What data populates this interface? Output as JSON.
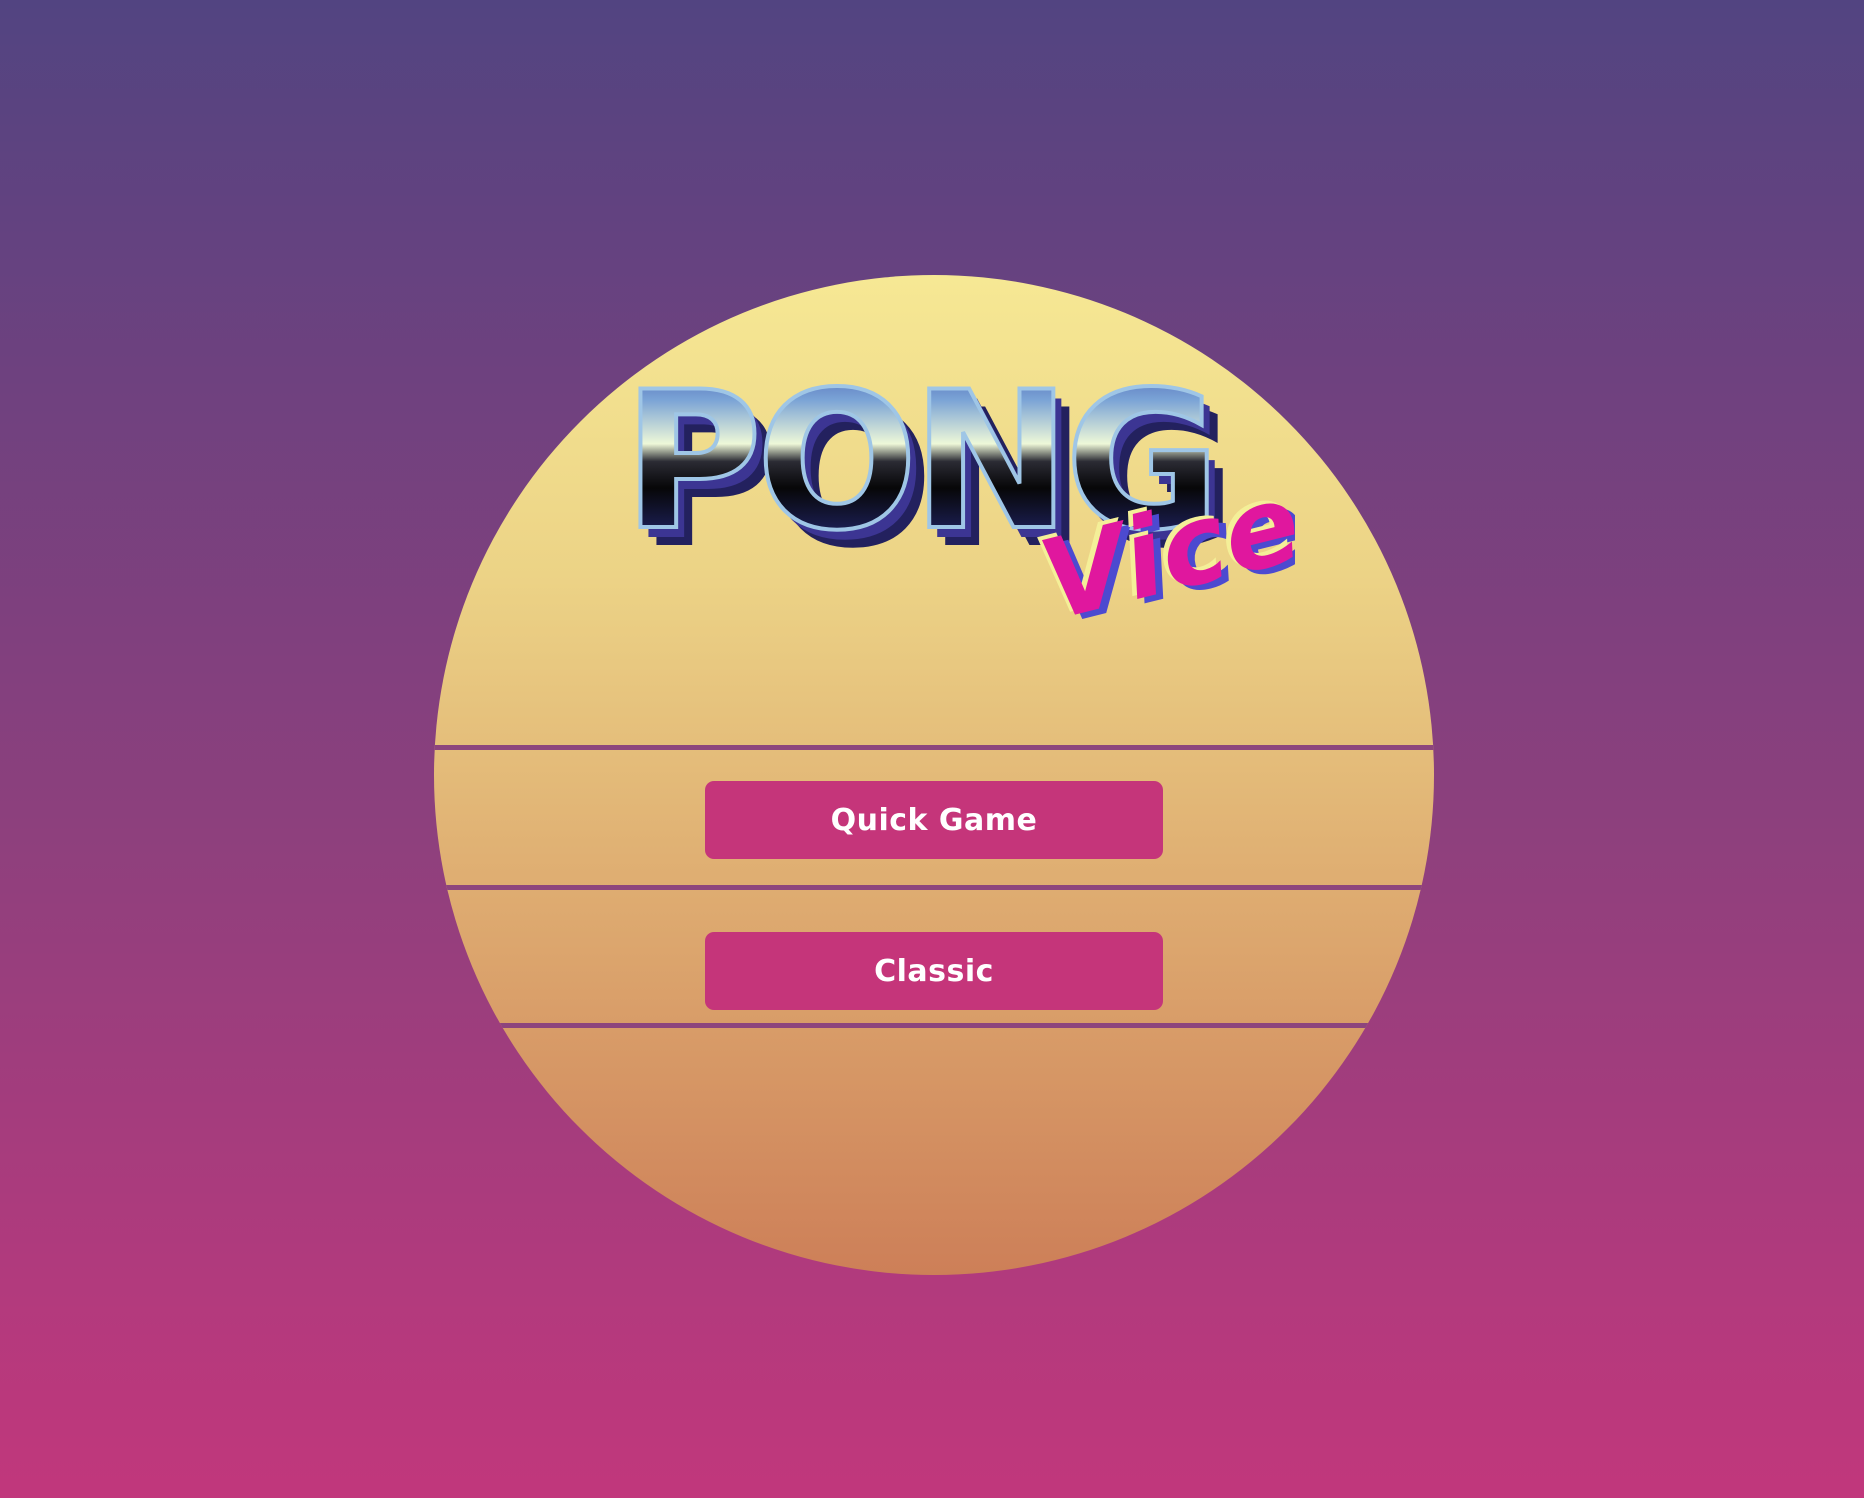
{
  "logo": {
    "title": "PONG",
    "subtitle": "Vice"
  },
  "menu": {
    "quick_game_label": "Quick Game",
    "classic_label": "Classic"
  },
  "colors": {
    "background_top": "#524481",
    "background_bottom": "#c1377c",
    "sun_top": "#f6e894",
    "sun_bottom": "#cd7f58",
    "button": "#c5357a",
    "button_text": "#ffffff"
  }
}
